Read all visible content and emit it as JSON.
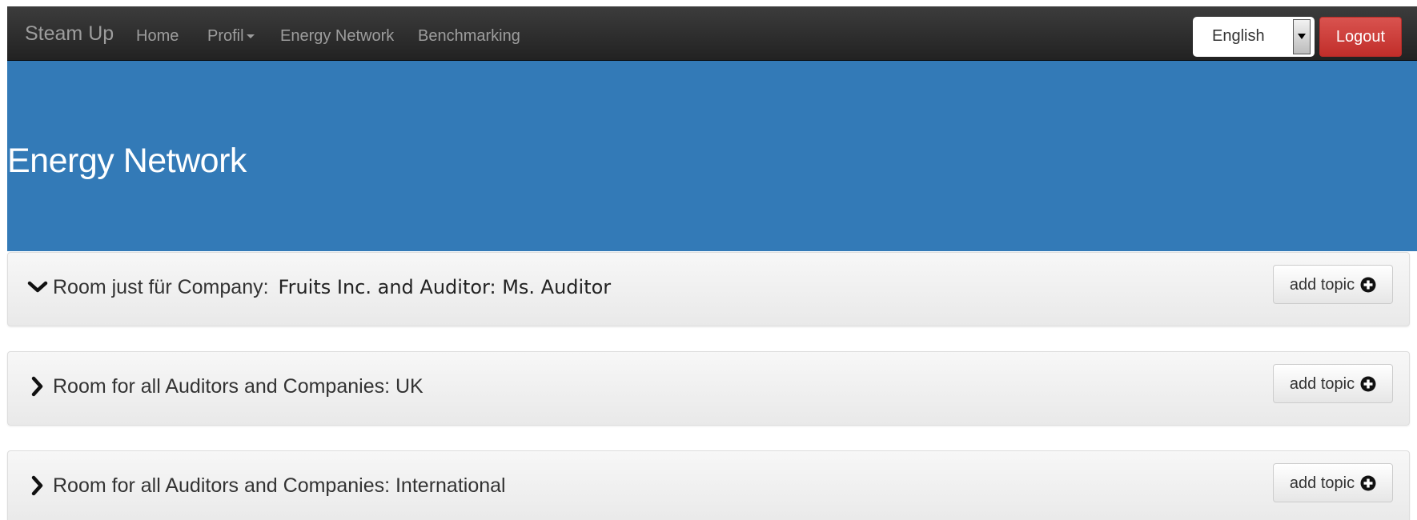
{
  "navbar": {
    "brand": "Steam Up",
    "links": [
      {
        "label": "Home"
      },
      {
        "label": "Profil"
      },
      {
        "label": "Energy Network"
      },
      {
        "label": "Benchmarking"
      }
    ],
    "language": {
      "selected": "English"
    },
    "logout_label": "Logout",
    "logout_color": "#d9534f"
  },
  "hero": {
    "title": "Energy Network",
    "background": "#337ab7"
  },
  "rooms": [
    {
      "expanded": true,
      "icon": "chevron-down-icon",
      "label": "Room just für Company:",
      "suffix": "Fruits Inc. and Auditor: Ms. Auditor",
      "button_label": "add topic"
    },
    {
      "expanded": false,
      "icon": "chevron-right-icon",
      "label": "Room for all Auditors and Companies: UK",
      "suffix": "",
      "button_label": "add topic"
    },
    {
      "expanded": false,
      "icon": "chevron-right-icon",
      "label": "Room for all Auditors and Companies: International",
      "suffix": "",
      "button_label": "add topic"
    }
  ]
}
